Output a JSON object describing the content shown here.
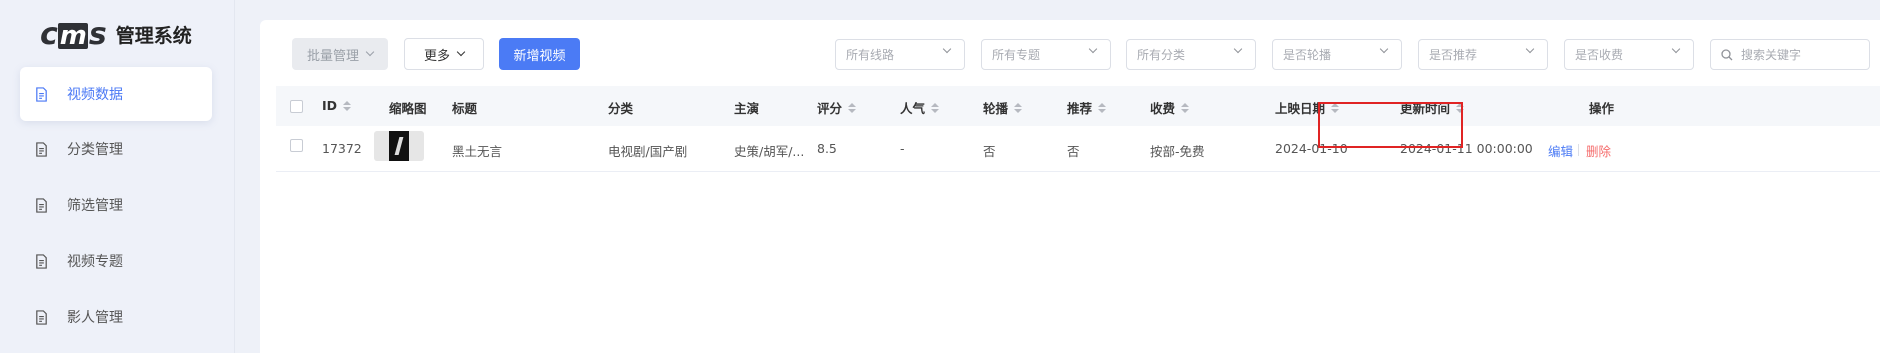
{
  "app": {
    "logo_text": "cms",
    "title": "管理系统"
  },
  "sidebar": {
    "items": [
      {
        "label": "视频数据",
        "active": true
      },
      {
        "label": "分类管理",
        "active": false
      },
      {
        "label": "筛选管理",
        "active": false
      },
      {
        "label": "视频专题",
        "active": false
      },
      {
        "label": "影人管理",
        "active": false
      }
    ]
  },
  "toolbar": {
    "batch_label": "批量管理",
    "more_label": "更多",
    "add_label": "新增视频"
  },
  "filters": {
    "line": "所有线路",
    "topic": "所有专题",
    "category": "所有分类",
    "carousel": "是否轮播",
    "recommend": "是否推荐",
    "paid": "是否收费",
    "search_placeholder": "搜索关键字"
  },
  "table": {
    "headers": {
      "id": "ID",
      "thumb": "缩略图",
      "title": "标题",
      "category": "分类",
      "cast": "主演",
      "score": "评分",
      "popularity": "人气",
      "carousel": "轮播",
      "recommend": "推荐",
      "paid": "收费",
      "release": "上映日期",
      "updated": "更新时间",
      "actions": "操作"
    },
    "rows": [
      {
        "id": "17372",
        "title": "黑土无言",
        "category": "电视剧/国产剧",
        "cast": "史策/胡军/...",
        "score": "8.5",
        "popularity": "-",
        "carousel": "否",
        "recommend": "否",
        "paid": "按部-免费",
        "release": "2024-01-10",
        "updated": "2024-01-11 00:00:00",
        "edit": "编辑",
        "delete": "删除"
      }
    ]
  },
  "colors": {
    "accent": "#4b7bf5",
    "danger": "#f56c6c",
    "highlight": "#e02424"
  }
}
